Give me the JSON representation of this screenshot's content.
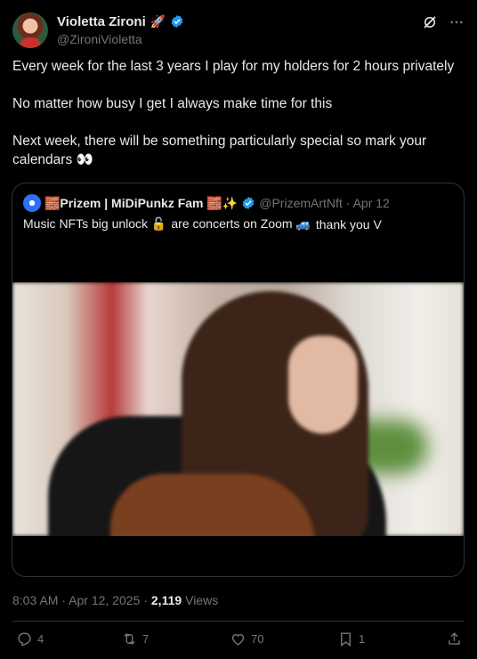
{
  "author": {
    "display_name": "Violetta Zironi",
    "handle": "@ZironiVioletta",
    "avatar_icon": "profile-avatar",
    "rocket_emoji": "🚀"
  },
  "tweet": {
    "paragraphs": [
      "Every week for the last 3 years I play for my holders for 2 hours privately",
      "No matter how busy I get I always make time for this",
      "Next week, there will be something particularly special so mark your calendars 👀"
    ]
  },
  "quote": {
    "name": "🧱Prizem | MiDiPunkz Fam 🧱✨",
    "handle": "@PrizemArtNft",
    "date": "· Apr 12",
    "text_part1": "Music NFTs big unlock 🔓",
    "text_part2": "are concerts on Zoom 🚙",
    "text_part3": "thank you V",
    "media_description_icon": "video-thumbnail"
  },
  "meta": {
    "time": "8:03 AM",
    "date": "· Apr 12, 2025 ·",
    "views_count": "2,119",
    "views_label": "Views"
  },
  "actions": {
    "replies": "4",
    "reposts": "7",
    "likes": "70",
    "bookmarks": "1"
  },
  "colors": {
    "background": "#000000",
    "text": "#e7e9ea",
    "muted": "#71767b",
    "border": "#2f3336",
    "verified": "#1d9bf0"
  }
}
